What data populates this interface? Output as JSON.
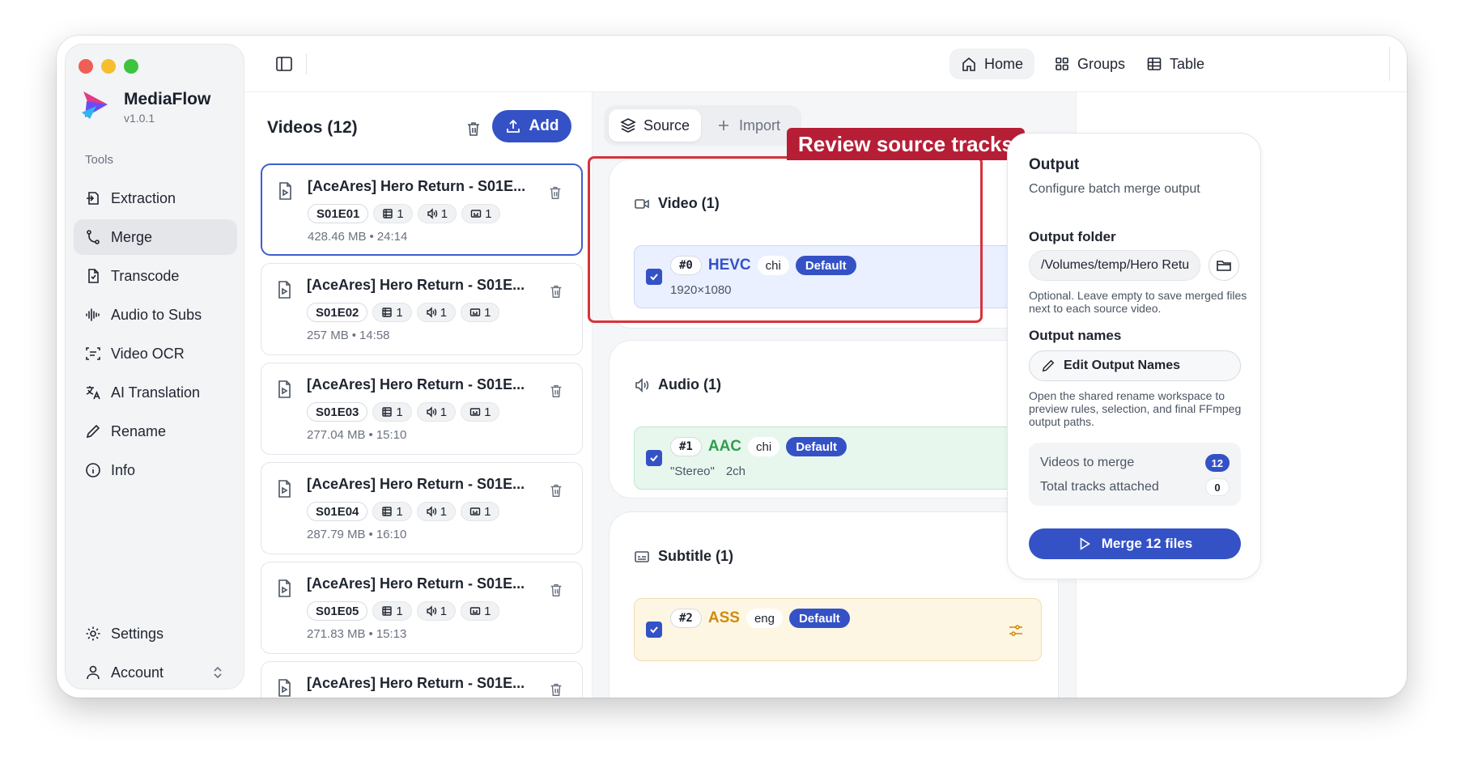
{
  "app": {
    "name": "MediaFlow",
    "version": "v1.0.1"
  },
  "sidebar": {
    "section_label": "Tools",
    "items": [
      {
        "label": "Extraction",
        "icon": "extraction-icon"
      },
      {
        "label": "Merge",
        "icon": "merge-icon",
        "active": true
      },
      {
        "label": "Transcode",
        "icon": "file-icon"
      },
      {
        "label": "Audio to Subs",
        "icon": "waveform-icon"
      },
      {
        "label": "Video OCR",
        "icon": "scan-icon"
      },
      {
        "label": "AI Translation",
        "icon": "translate-icon"
      },
      {
        "label": "Rename",
        "icon": "pencil-icon"
      },
      {
        "label": "Info",
        "icon": "info-icon"
      }
    ],
    "bottom": [
      {
        "label": "Settings",
        "icon": "gear-icon"
      },
      {
        "label": "Account",
        "icon": "user-icon"
      }
    ]
  },
  "topbar": {
    "home": "Home",
    "groups": "Groups",
    "table": "Table"
  },
  "videos": {
    "title": "Videos (12)",
    "add_label": "Add",
    "items": [
      {
        "title": "[AceAres] Hero Return - S01E...",
        "episode": "S01E01",
        "v": "1",
        "a": "1",
        "s": "1",
        "size": "428.46 MB",
        "duration": "24:14"
      },
      {
        "title": "[AceAres] Hero Return - S01E...",
        "episode": "S01E02",
        "v": "1",
        "a": "1",
        "s": "1",
        "size": "257 MB",
        "duration": "14:58"
      },
      {
        "title": "[AceAres] Hero Return - S01E...",
        "episode": "S01E03",
        "v": "1",
        "a": "1",
        "s": "1",
        "size": "277.04 MB",
        "duration": "15:10"
      },
      {
        "title": "[AceAres] Hero Return - S01E...",
        "episode": "S01E04",
        "v": "1",
        "a": "1",
        "s": "1",
        "size": "287.79 MB",
        "duration": "16:10"
      },
      {
        "title": "[AceAres] Hero Return - S01E...",
        "episode": "S01E05",
        "v": "1",
        "a": "1",
        "s": "1",
        "size": "271.83 MB",
        "duration": "15:13"
      },
      {
        "title": "[AceAres] Hero Return - S01E..."
      }
    ]
  },
  "tracks": {
    "tabs": {
      "source": "Source",
      "import": "Import"
    },
    "callout": "Review source tracks",
    "groups": [
      {
        "title": "Video (1)",
        "index": "#0",
        "codec": "HEVC",
        "lang": "chi",
        "default_label": "Default",
        "detail1": "1920×1080",
        "detail2": "",
        "color": "#3452c6"
      },
      {
        "title": "Audio (1)",
        "index": "#1",
        "codec": "AAC",
        "lang": "chi",
        "default_label": "Default",
        "detail1": "\"Stereo\"",
        "detail2": "2ch",
        "color": "#2f9e4f"
      },
      {
        "title": "Subtitle (1)",
        "index": "#2",
        "codec": "ASS",
        "lang": "eng",
        "default_label": "Default",
        "detail1": "",
        "detail2": "",
        "color": "#d08a0c"
      }
    ]
  },
  "output": {
    "title": "Output",
    "desc": "Configure batch merge output",
    "folder_label": "Output folder",
    "folder_value": "/Volumes/temp/Hero Retu",
    "folder_hint": "Optional. Leave empty to save merged files next to each source video.",
    "names_label": "Output names",
    "edit_names": "Edit Output Names",
    "names_hint": "Open the shared rename workspace to preview rules, selection, and final FFmpeg output paths.",
    "videos_to_merge_label": "Videos to merge",
    "videos_to_merge": "12",
    "tracks_attached_label": "Total tracks attached",
    "tracks_attached": "0",
    "merge_button": "Merge 12 files"
  },
  "colors": {
    "accent": "#3452c6",
    "callout": "#d6333b"
  }
}
